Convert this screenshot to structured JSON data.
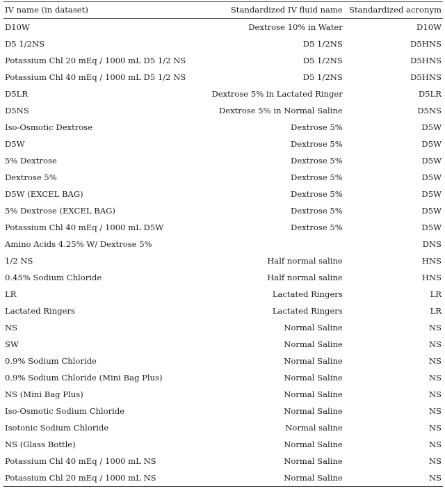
{
  "table": {
    "columns": [
      {
        "id": "iv_name",
        "label": "IV name (in dataset)",
        "align": "left"
      },
      {
        "id": "fluid_name",
        "label": "Standardized IV fluid name",
        "align": "right"
      },
      {
        "id": "acronym",
        "label": "Standardized acronym",
        "align": "right"
      }
    ],
    "rows": [
      {
        "iv_name": "D10W",
        "fluid_name": "Dextrose 10% in Water",
        "acronym": "D10W"
      },
      {
        "iv_name": "D5 1/2NS",
        "fluid_name": "D5 1/2NS",
        "acronym": "D5HNS"
      },
      {
        "iv_name": "Potassium Chl 20 mEq / 1000 mL D5 1/2 NS",
        "fluid_name": "D5 1/2NS",
        "acronym": "D5HNS"
      },
      {
        "iv_name": "Potassium Chl 40 mEq / 1000 mL D5 1/2 NS",
        "fluid_name": "D5 1/2NS",
        "acronym": "D5HNS"
      },
      {
        "iv_name": "D5LR",
        "fluid_name": "Dextrose 5% in Lactated Ringer",
        "acronym": "D5LR"
      },
      {
        "iv_name": "D5NS",
        "fluid_name": "Dextrose 5% in Normal Saline",
        "acronym": "D5NS"
      },
      {
        "iv_name": "Iso-Osmotic Dextrose",
        "fluid_name": "Dextrose 5%",
        "acronym": "D5W"
      },
      {
        "iv_name": "D5W",
        "fluid_name": "Dextrose 5%",
        "acronym": "D5W"
      },
      {
        "iv_name": "5% Dextrose",
        "fluid_name": "Dextrose 5%",
        "acronym": "D5W"
      },
      {
        "iv_name": "Dextrose 5%",
        "fluid_name": "Dextrose 5%",
        "acronym": "D5W"
      },
      {
        "iv_name": "D5W (EXCEL BAG)",
        "fluid_name": "Dextrose 5%",
        "acronym": "D5W"
      },
      {
        "iv_name": "5% Dextrose (EXCEL BAG)",
        "fluid_name": "Dextrose 5%",
        "acronym": "D5W"
      },
      {
        "iv_name": "Potassium Chl 40 mEq / 1000 mL D5W",
        "fluid_name": "Dextrose 5%",
        "acronym": "D5W"
      },
      {
        "iv_name": "Amino Acids 4.25% W/ Dextrose 5%",
        "fluid_name": "",
        "acronym": "DNS"
      },
      {
        "iv_name": "1/2 NS",
        "fluid_name": "Half normal saline",
        "acronym": "HNS"
      },
      {
        "iv_name": "0.45% Sodium Chloride",
        "fluid_name": "Half normal saline",
        "acronym": "HNS"
      },
      {
        "iv_name": "LR",
        "fluid_name": "Lactated Ringers",
        "acronym": "LR"
      },
      {
        "iv_name": "Lactated Ringers",
        "fluid_name": "Lactated Ringers",
        "acronym": "LR"
      },
      {
        "iv_name": "NS",
        "fluid_name": "Normal Saline",
        "acronym": "NS"
      },
      {
        "iv_name": "SW",
        "fluid_name": "Normal Saline",
        "acronym": "NS"
      },
      {
        "iv_name": "0.9% Sodium Chloride",
        "fluid_name": "Normal Saline",
        "acronym": "NS"
      },
      {
        "iv_name": "0.9% Sodium Chloride (Mini Bag Plus)",
        "fluid_name": "Normal Saline",
        "acronym": "NS"
      },
      {
        "iv_name": "NS (Mini Bag Plus)",
        "fluid_name": "Normal Saline",
        "acronym": "NS"
      },
      {
        "iv_name": "Iso-Osmotic Sodium Chloride",
        "fluid_name": "Normal Saline",
        "acronym": "NS"
      },
      {
        "iv_name": "Isotonic Sodium Chloride",
        "fluid_name": "Normal saline",
        "acronym": "NS"
      },
      {
        "iv_name": "NS (Glass Bottle)",
        "fluid_name": "Normal Saline",
        "acronym": "NS"
      },
      {
        "iv_name": "Potassium Chl 40 mEq / 1000 mL NS",
        "fluid_name": "Normal Saline",
        "acronym": "NS"
      },
      {
        "iv_name": "Potassium Chl 20 mEq / 1000 mL NS",
        "fluid_name": "Normal Saline",
        "acronym": "NS"
      }
    ]
  },
  "style": {
    "rule_color": "#4a4a4a",
    "text_color": "#1a1a1a",
    "background": "#ffffff"
  }
}
